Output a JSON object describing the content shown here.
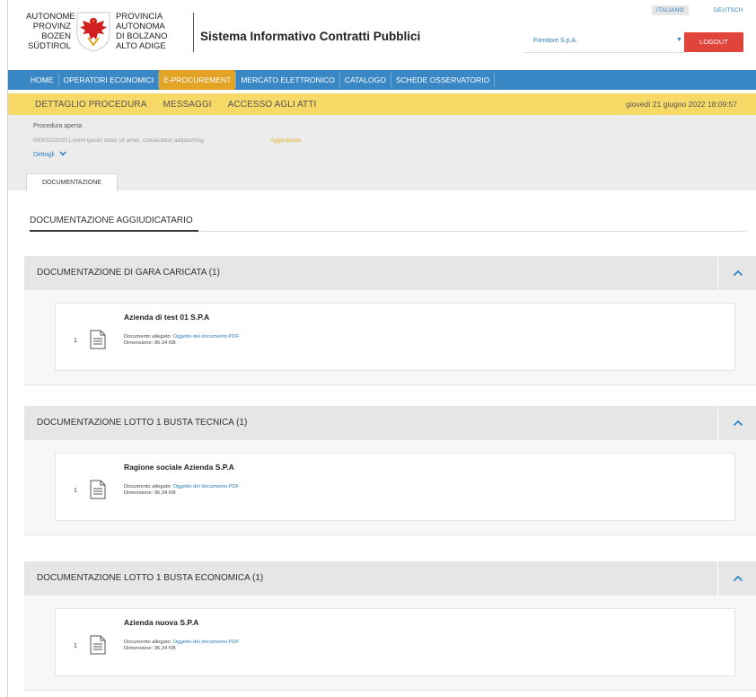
{
  "header": {
    "logo_left": [
      "AUTONOME",
      "PROVINZ",
      "BOZEN",
      "SÜDTIROL"
    ],
    "logo_right": [
      "PROVINCIA",
      "AUTONOMA",
      "DI BOLZANO",
      "ALTO ADIGE"
    ],
    "app_title": "Sistema Informativo Contratti Pubblici",
    "languages": [
      "ITALIANO",
      "DEUTSCH"
    ],
    "supplier": "Fornitore S.p.A.",
    "logout": "LOGOUT"
  },
  "nav": {
    "items": [
      "HOME",
      "OPERATORI ECONOMICI",
      "E-PROCUREMENT",
      "MERCATO ELETTRONICO",
      "CATALOGO",
      "SCHEDE OSSERVATORIO"
    ],
    "active": "E-PROCUREMENT"
  },
  "subnav": {
    "items": [
      "DETTAGLIO PROCEDURA",
      "MESSAGGI",
      "ACCESSO AGLI ATTI"
    ],
    "date": "giovedì 21 giugno 2022 18:09:57"
  },
  "procedure": {
    "type": "Procedura aperta",
    "description": "000012/2020 Lorem ipsum dolor sit amet, consectetur adipisching",
    "status": "Aggiudicata",
    "details_link": "Dettagli",
    "tab": "DOCUMENTAZIONE"
  },
  "main": {
    "title": "DOCUMENTAZIONE AGGIUDICATARIO",
    "sections": [
      {
        "label": "DOCUMENTAZIONE DI GARA CARICATA (1)",
        "item": {
          "num": "1",
          "name": "Azienda di test 01 S.P.A",
          "att_label": "Documento allegato:",
          "att_link": "Oggetto del documento.PDF",
          "size": "Dimensione: 96.34 KB"
        }
      },
      {
        "label": "DOCUMENTAZIONE LOTTO 1 BUSTA TECNICA (1)",
        "item": {
          "num": "1",
          "name": "Ragione sociale Azienda  S.P.A",
          "att_label": "Documento allegato:",
          "att_link": "Oggetto del documento.PDF",
          "size": "Dimensione: 96.34 KB"
        }
      },
      {
        "label": "DOCUMENTAZIONE LOTTO 1 BUSTA ECONOMICA (1)",
        "item": {
          "num": "1",
          "name": "Azienda nuova S.P.A",
          "att_label": "Documento allegato:",
          "att_link": "Oggetto del documento.PDF",
          "size": "Dimensione: 96.34 KB"
        }
      }
    ]
  },
  "colors": {
    "nav_blue": "#3a87c6",
    "active_orange": "#e3a325",
    "subnav_yellow": "#f6d966",
    "logout_red": "#e0443b",
    "link_blue": "#2a7fc0"
  }
}
